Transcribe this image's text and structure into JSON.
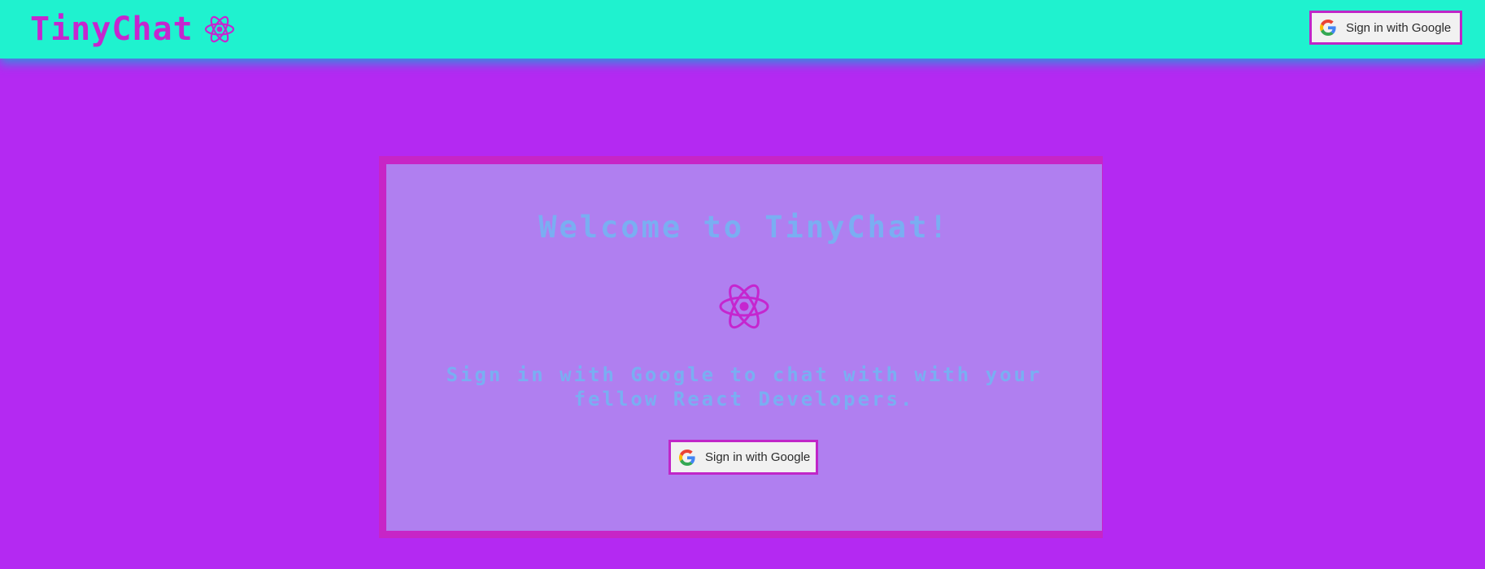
{
  "header": {
    "app_title": "TinyChat",
    "logo_icon": "react-atom-icon",
    "sign_in_label": "Sign in with Google"
  },
  "main": {
    "welcome_title": "Welcome to TinyChat!",
    "logo_icon": "react-atom-icon",
    "subtitle": "Sign in with Google to chat with with your fellow React Developers.",
    "sign_in_label": "Sign in with Google"
  },
  "icons": {
    "google": "google-g-icon",
    "react": "react-atom-icon"
  },
  "colors": {
    "page_background": "#b429f2",
    "header_background": "#1ff2cf",
    "brand": "#c526cf",
    "card_background": "#b07ff0",
    "card_shadow": "#c725c6",
    "heading_text": "#7aaef2",
    "button_border": "#c026c8",
    "button_background": "#f1f1f1"
  }
}
